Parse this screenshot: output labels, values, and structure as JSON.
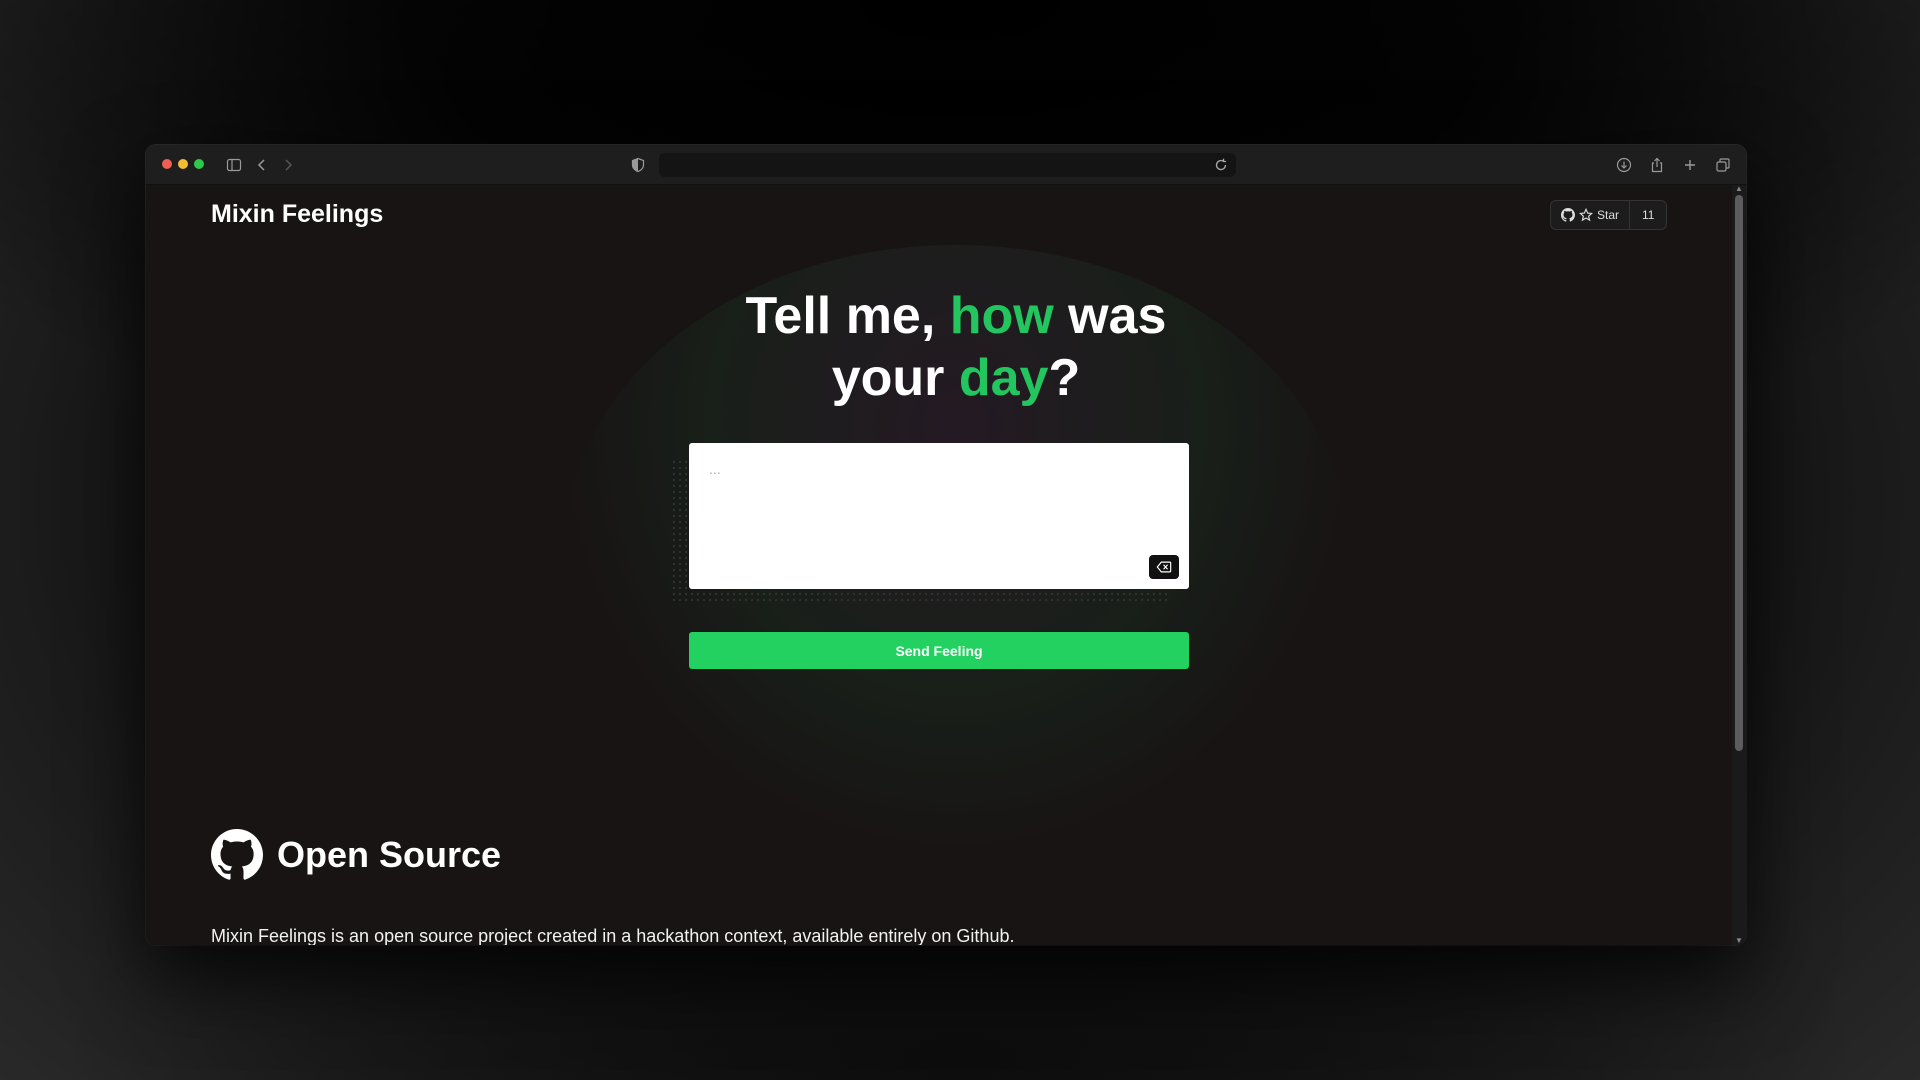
{
  "site": {
    "title": "Mixin Feelings"
  },
  "github_button": {
    "star_label": "Star",
    "star_count": "11"
  },
  "hero": {
    "part1": "Tell me, ",
    "accent1": "how",
    "part2": " was",
    "part3": "your ",
    "accent2": "day",
    "part4": "?"
  },
  "feeling_input": {
    "placeholder": "..."
  },
  "send_button": {
    "label": "Send Feeling"
  },
  "open_source": {
    "title": "Open Source",
    "description": "Mixin Feelings is an open source project created in a hackathon context, available entirely on Github."
  },
  "colors": {
    "accent": "#22c55e",
    "button": "#22d160",
    "page_bg": "#181414"
  }
}
